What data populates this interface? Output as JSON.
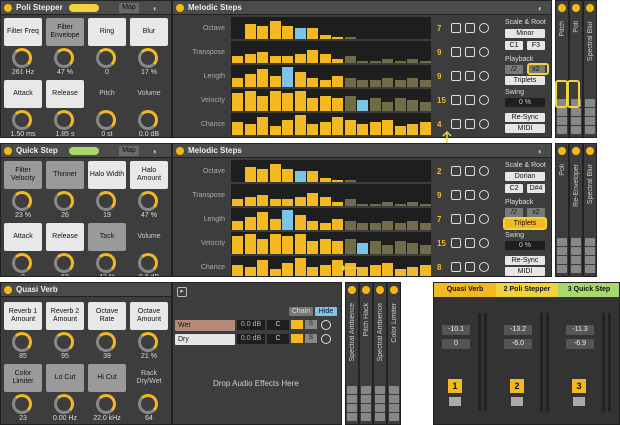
{
  "device1": {
    "title": "Poli Stepper",
    "map": "Map",
    "macros": [
      {
        "label": "Filter Freq",
        "value": "261 Hz",
        "style": "on"
      },
      {
        "label": "Filter Envelope",
        "value": "47 %",
        "style": "dk"
      },
      {
        "label": "Ring",
        "value": "0",
        "style": "on"
      },
      {
        "label": "Blur",
        "value": "17 %",
        "style": "on"
      },
      {
        "label": "Attack",
        "value": "1.50 ms",
        "style": "on"
      },
      {
        "label": "Release",
        "value": "1.85 s",
        "style": "on"
      },
      {
        "label": "Pitch",
        "value": "0 st",
        "style": "no"
      },
      {
        "label": "Volume",
        "value": "0.0 dB",
        "style": "no"
      }
    ]
  },
  "steps1": {
    "title": "Melodic Steps",
    "rows": [
      {
        "label": "Octave",
        "num": "7"
      },
      {
        "label": "Transpose",
        "num": "9"
      },
      {
        "label": "Length",
        "num": "9"
      },
      {
        "label": "Velocity",
        "num": "15"
      },
      {
        "label": "Chance",
        "num": "4"
      }
    ],
    "scale_title": "Scale & Root",
    "scale": "Minor",
    "root_a": "C1",
    "root_b": "F3",
    "playback": "Playback",
    "x2a": "/2",
    "x2b": "x2",
    "triplets": "Triplets",
    "swing": "Swing",
    "swing_val": "0 %",
    "resync": "Re-Sync",
    "midi": "MIDI"
  },
  "stripes1": [
    "Pitch",
    "Poli",
    "Spectral Blur"
  ],
  "device2": {
    "title": "Quick Step",
    "map": "Map",
    "macros": [
      {
        "label": "Filter Velocity",
        "value": "23 %",
        "style": "dk"
      },
      {
        "label": "Thinner",
        "value": "26",
        "style": "dk"
      },
      {
        "label": "Halo Width",
        "value": "19",
        "style": "on"
      },
      {
        "label": "Halo Amount",
        "value": "47 %",
        "style": "on"
      },
      {
        "label": "Attack",
        "value": "0",
        "style": "on"
      },
      {
        "label": "Release",
        "value": "58",
        "style": "on"
      },
      {
        "label": "Tack",
        "value": "43 %",
        "style": "dk"
      },
      {
        "label": "Volume",
        "value": "0.0 dB",
        "style": "no"
      }
    ]
  },
  "steps2": {
    "title": "Melodic Steps",
    "rows": [
      {
        "label": "Octave",
        "num": "2"
      },
      {
        "label": "Transpose",
        "num": "9"
      },
      {
        "label": "Length",
        "num": "7"
      },
      {
        "label": "Velocity",
        "num": "15"
      },
      {
        "label": "Chance",
        "num": "8"
      }
    ],
    "scale_title": "Scale & Root",
    "scale": "Dorian",
    "root_a": "C2",
    "root_b": "D#4",
    "playback": "Playback",
    "x2a": "/2",
    "x2b": "x2",
    "triplets": "Triplets",
    "swing": "Swing",
    "swing_val": "0 %",
    "resync": "Re-Sync",
    "midi": "MIDI"
  },
  "stripes2": [
    "Poli",
    "Re-Enveloper",
    "Spectral Blur"
  ],
  "device3": {
    "title": "Quasi Verb",
    "macros": [
      {
        "label": "Reverb 1 Amount",
        "value": "85",
        "style": "on"
      },
      {
        "label": "Reverb 2 Amount",
        "value": "95",
        "style": "on"
      },
      {
        "label": "Octave Rate",
        "value": "39",
        "style": "on"
      },
      {
        "label": "Octave Amount",
        "value": "21 %",
        "style": "on"
      },
      {
        "label": "Color Limiter",
        "value": "23",
        "style": "dk"
      },
      {
        "label": "Lo Cut",
        "value": "0.00 Hz",
        "style": "dk"
      },
      {
        "label": "Hi Cut",
        "value": "22.0 kHz",
        "style": "dk"
      },
      {
        "label": "Rack Dry/Wet",
        "value": "64",
        "style": "no"
      }
    ]
  },
  "chain": {
    "chain_label": "Chain",
    "hide_label": "Hide",
    "rows": [
      {
        "name": "Wet",
        "vol": "0.0 dB",
        "pan": "C",
        "s": "S"
      },
      {
        "name": "Dry",
        "vol": "0.0 dB",
        "pan": "C",
        "s": "S"
      }
    ],
    "drop": "Drop Audio Effects Here"
  },
  "stripes3": [
    "Spectral Ambience",
    "Pitch Hack",
    "Spectral Ambience",
    "Color Limiter"
  ],
  "mixer": {
    "channels": [
      {
        "name": "Quasi Verb",
        "vol": "-10.1",
        "pan": "0",
        "num": "1",
        "color": "#f3b922"
      },
      {
        "name": "2 Poli Stepper",
        "vol": "-13.2",
        "pan": "-6.0",
        "num": "2",
        "color": "#f3d33a"
      },
      {
        "name": "3 Quick Step",
        "vol": "-11.3",
        "pan": "-6.9",
        "num": "3",
        "color": "#a8d86b"
      }
    ]
  }
}
